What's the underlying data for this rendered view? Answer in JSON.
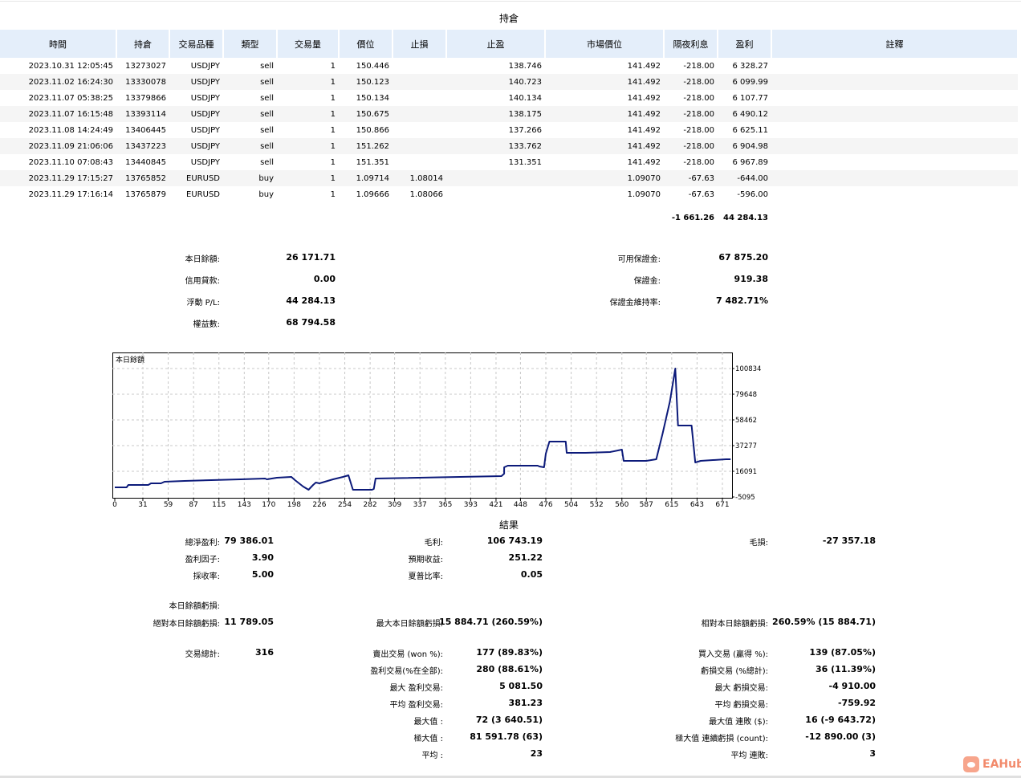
{
  "positions": {
    "title": "持倉",
    "columns": [
      "時間",
      "持倉",
      "交易品種",
      "類型",
      "交易量",
      "價位",
      "止損",
      "止盈",
      "市場價位",
      "隔夜利息",
      "盈利",
      "註釋"
    ],
    "rows": [
      [
        "2023.10.31 12:05:45",
        "13273027",
        "USDJPY",
        "sell",
        "1",
        "150.446",
        "",
        "138.746",
        "141.492",
        "-218.00",
        "6 328.27",
        ""
      ],
      [
        "2023.11.02 16:24:30",
        "13330078",
        "USDJPY",
        "sell",
        "1",
        "150.123",
        "",
        "140.723",
        "141.492",
        "-218.00",
        "6 099.99",
        ""
      ],
      [
        "2023.11.07 05:38:25",
        "13379866",
        "USDJPY",
        "sell",
        "1",
        "150.134",
        "",
        "140.134",
        "141.492",
        "-218.00",
        "6 107.77",
        ""
      ],
      [
        "2023.11.07 16:15:48",
        "13393114",
        "USDJPY",
        "sell",
        "1",
        "150.675",
        "",
        "138.175",
        "141.492",
        "-218.00",
        "6 490.12",
        ""
      ],
      [
        "2023.11.08 14:24:49",
        "13406445",
        "USDJPY",
        "sell",
        "1",
        "150.866",
        "",
        "137.266",
        "141.492",
        "-218.00",
        "6 625.11",
        ""
      ],
      [
        "2023.11.09 21:06:06",
        "13437223",
        "USDJPY",
        "sell",
        "1",
        "151.262",
        "",
        "133.762",
        "141.492",
        "-218.00",
        "6 904.98",
        ""
      ],
      [
        "2023.11.10 07:08:43",
        "13440845",
        "USDJPY",
        "sell",
        "1",
        "151.351",
        "",
        "131.351",
        "141.492",
        "-218.00",
        "6 967.89",
        ""
      ],
      [
        "2023.11.29 17:15:27",
        "13765852",
        "EURUSD",
        "buy",
        "1",
        "1.09714",
        "1.08014",
        "",
        "1.09070",
        "-67.63",
        "-644.00",
        ""
      ],
      [
        "2023.11.29 17:16:14",
        "13765879",
        "EURUSD",
        "buy",
        "1",
        "1.09666",
        "1.08066",
        "",
        "1.09070",
        "-67.63",
        "-596.00",
        ""
      ]
    ],
    "total_swap": "-1 661.26",
    "total_profit": "44 284.13"
  },
  "summary": {
    "left": [
      {
        "label": "本日餘額:",
        "value": "26 171.71"
      },
      {
        "label": "信用貸款:",
        "value": "0.00"
      },
      {
        "label": "浮動 P/L:",
        "value": "44 284.13"
      },
      {
        "label": "權益數:",
        "value": "68 794.58"
      }
    ],
    "right": [
      {
        "label": "可用保證金:",
        "value": "67 875.20"
      },
      {
        "label": "保證金:",
        "value": "919.38"
      },
      {
        "label": "保證金維持率:",
        "value": "7 482.71%"
      }
    ]
  },
  "chart_data": {
    "type": "line",
    "title": "本日餘額",
    "xlabel": "",
    "ylabel": "",
    "xlim": [
      0,
      682
    ],
    "ylim": [
      -5095,
      100834
    ],
    "xticks": [
      0,
      31,
      59,
      87,
      115,
      143,
      170,
      198,
      226,
      254,
      282,
      309,
      337,
      365,
      393,
      421,
      448,
      476,
      504,
      532,
      560,
      587,
      615,
      643,
      671
    ],
    "yticks": [
      -5095,
      16091,
      37277,
      58462,
      79648,
      100834
    ],
    "grid": true,
    "line_color": "#0c1a7a",
    "series": [
      {
        "name": "本日餘額",
        "points": [
          [
            0,
            2849
          ],
          [
            13,
            2849
          ],
          [
            15,
            4835
          ],
          [
            37,
            4835
          ],
          [
            40,
            6159
          ],
          [
            51,
            6159
          ],
          [
            55,
            7483
          ],
          [
            77,
            8145
          ],
          [
            139,
            9469
          ],
          [
            166,
            10131
          ],
          [
            168,
            9469
          ],
          [
            179,
            10793
          ],
          [
            195,
            11455
          ],
          [
            199,
            8807
          ],
          [
            208,
            3511
          ],
          [
            214,
            863
          ],
          [
            219,
            4835
          ],
          [
            222,
            6821
          ],
          [
            226,
            6159
          ],
          [
            232,
            7483
          ],
          [
            241,
            9469
          ],
          [
            252,
            11455
          ],
          [
            258,
            12779
          ],
          [
            261,
            5497
          ],
          [
            263,
            863
          ],
          [
            284,
            863
          ],
          [
            286,
            1525
          ],
          [
            288,
            10131
          ],
          [
            427,
            12117
          ],
          [
            430,
            14103
          ],
          [
            430,
            19399
          ],
          [
            434,
            20723
          ],
          [
            467,
            20723
          ],
          [
            469,
            20061
          ],
          [
            474,
            19399
          ],
          [
            476,
            30653
          ],
          [
            480,
            40583
          ],
          [
            498,
            40583
          ],
          [
            499,
            31315
          ],
          [
            520,
            31315
          ],
          [
            547,
            31977
          ],
          [
            560,
            33963
          ],
          [
            562,
            24695
          ],
          [
            587,
            24695
          ],
          [
            598,
            26019
          ],
          [
            605,
            47203
          ],
          [
            613,
            73683
          ],
          [
            619,
            100825
          ],
          [
            622,
            53823
          ],
          [
            637,
            53823
          ],
          [
            641,
            23371
          ],
          [
            647,
            24695
          ],
          [
            675,
            26019
          ],
          [
            680,
            26019
          ]
        ]
      }
    ]
  },
  "results": {
    "title": "結果",
    "rows": [
      [
        "總淨盈利:",
        "79 386.01",
        "毛利:",
        "106 743.19",
        "毛損:",
        "-27 357.18"
      ],
      [
        "盈利因子:",
        "3.90",
        "預期收益:",
        "251.22",
        "",
        ""
      ],
      [
        "採收率:",
        "5.00",
        "夏普比率:",
        "0.05",
        "",
        ""
      ],
      [
        "本日餘額虧損:",
        "",
        "",
        "",
        "",
        ""
      ],
      [
        "絕對本日餘額虧損:",
        "11 789.05",
        "最大本日餘額虧損:",
        "15 884.71 (260.59%)",
        "相對本日餘額虧損:",
        "260.59% (15 884.71)"
      ],
      [
        "交易總計:",
        "316",
        "賣出交易 (won %):",
        "177 (89.83%)",
        "買入交易 (贏得 %):",
        "139 (87.05%)"
      ],
      [
        "",
        "",
        "盈利交易(%在全部):",
        "280 (88.61%)",
        "虧損交易 (%總計):",
        "36 (11.39%)"
      ],
      [
        "",
        "",
        "最大 盈利交易:",
        "5 081.50",
        "最大 虧損交易:",
        "-4 910.00"
      ],
      [
        "",
        "",
        "平均 盈利交易:",
        "381.23",
        "平均 虧損交易:",
        "-759.92"
      ],
      [
        "",
        "",
        "最大值 :",
        "72 (3 640.51)",
        "最大值 連敗 ($):",
        "16 (-9 643.72)"
      ],
      [
        "",
        "",
        "極大值 :",
        "81 591.78 (63)",
        "極大值 連續虧損 (count):",
        "-12 890.00 (3)"
      ],
      [
        "",
        "",
        "平均 :",
        "23",
        "平均 連敗:",
        "3"
      ]
    ]
  },
  "watermark": {
    "text": "EAHub",
    "color": "#f28a6b"
  }
}
